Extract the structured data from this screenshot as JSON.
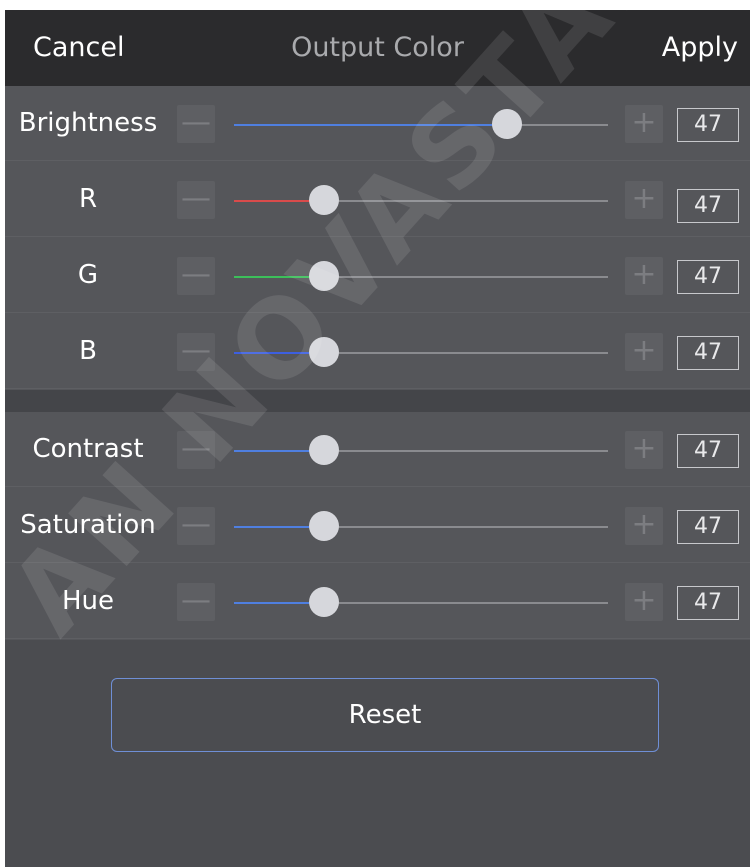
{
  "header": {
    "cancel_label": "Cancel",
    "title": "Output Color",
    "apply_label": "Apply"
  },
  "controls": {
    "minus_glyph": "—",
    "plus_glyph": "+"
  },
  "sliders": [
    {
      "id": "brightness",
      "label": "Brightness",
      "value": "47",
      "level": 0.73,
      "color": "#4f7fe0"
    },
    {
      "id": "r",
      "label": "R",
      "value": "47",
      "level": 0.24,
      "color": "#d94b4b"
    },
    {
      "id": "g",
      "label": "G",
      "value": "47",
      "level": 0.24,
      "color": "#3cbf5a"
    },
    {
      "id": "b",
      "label": "B",
      "value": "47",
      "level": 0.24,
      "color": "#3d5fe0"
    },
    {
      "id": "contrast",
      "label": "Contrast",
      "value": "47",
      "level": 0.24,
      "color": "#4f7fe0"
    },
    {
      "id": "saturation",
      "label": "Saturation",
      "value": "47",
      "level": 0.24,
      "color": "#4f7fe0"
    },
    {
      "id": "hue",
      "label": "Hue",
      "value": "47",
      "level": 0.24,
      "color": "#4f7fe0"
    }
  ],
  "reset_label": "Reset",
  "watermark_text": "AN NOVASTAR"
}
